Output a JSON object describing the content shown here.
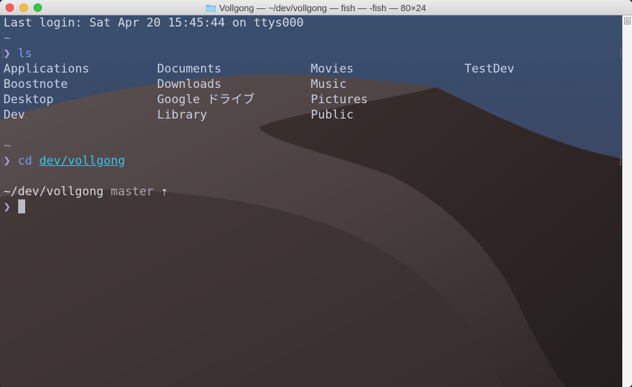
{
  "window": {
    "title": "Vollgong — ~/dev/vollgong — fish — -fish — 80×24"
  },
  "terminal": {
    "last_login": "Last login: Sat Apr 20 15:45:44 on ttys000",
    "tilde_1": "~",
    "prompt_char": "❯",
    "cmd_ls": "ls",
    "ls_columns": [
      [
        "Applications",
        "Boostnote",
        "Desktop",
        "Dev"
      ],
      [
        "Documents",
        "Downloads",
        "Google ドライブ",
        "Library"
      ],
      [
        "Movies",
        "Music",
        "Pictures",
        "Public"
      ],
      [
        "TestDev"
      ]
    ],
    "tilde_2": "~",
    "cmd_cd": "cd",
    "cd_arg": "dev/vollgong",
    "cwd": "~/dev/vollgong",
    "git_branch": "master",
    "git_status": "⇡"
  },
  "colors": {
    "prompt": "#b7a3e8",
    "command": "#6e9df5",
    "link": "#35c6ee",
    "background": "#323d4f"
  }
}
